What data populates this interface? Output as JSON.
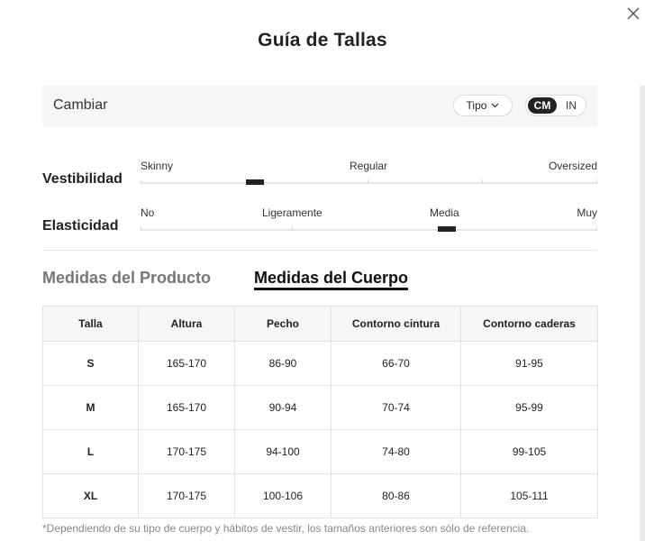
{
  "modal": {
    "title": "Guía de Tallas",
    "close_icon": "close-icon"
  },
  "unit_bar": {
    "label": "Cambiar",
    "type_button": "Tipo",
    "type_icon": "chevron-down-icon",
    "units": [
      "CM",
      "IN"
    ],
    "selected_unit": "CM"
  },
  "fit": {
    "label": "Vestibilidad",
    "scale": [
      "Skinny",
      "Regular",
      "Oversized"
    ],
    "level": 0.25
  },
  "elasticity": {
    "label": "Elasticidad",
    "scale": [
      "No",
      "Ligeramente",
      "Media",
      "Muy"
    ],
    "level": 0.67
  },
  "tabs": [
    {
      "label": "Medidas del Producto",
      "active": false
    },
    {
      "label": "Medidas del Cuerpo",
      "active": true
    }
  ],
  "table": {
    "headers": [
      "Talla",
      "Altura",
      "Pecho",
      "Contorno cintura",
      "Contorno caderas"
    ],
    "rows": [
      [
        "S",
        "165-170",
        "86-90",
        "66-70",
        "91-95"
      ],
      [
        "M",
        "165-170",
        "90-94",
        "70-74",
        "95-99"
      ],
      [
        "L",
        "170-175",
        "94-100",
        "74-80",
        "99-105"
      ],
      [
        "XL",
        "170-175",
        "100-106",
        "80-86",
        "105-111"
      ]
    ]
  },
  "footnote": "*Dependiendo de su tipo de cuerpo y hábitos de vestir, los tamaños anteriores son sólo de referencia."
}
